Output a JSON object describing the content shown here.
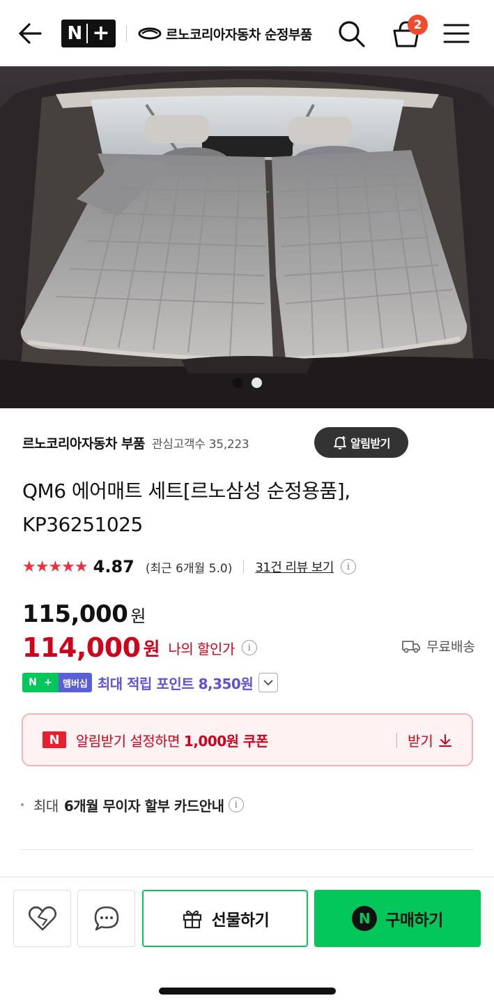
{
  "header": {
    "back_icon": "arrow-left-icon",
    "nplus_n": "N",
    "nplus_plus": "+",
    "brand_name": "르노코리아자동차 순정부품",
    "search_icon": "search-icon",
    "cart_icon": "shopping-bag-icon",
    "cart_count": "2",
    "menu_icon": "hamburger-menu-icon"
  },
  "gallery": {
    "image_alt": "car trunk with inflatable air mattress",
    "slides": 2,
    "active_index": 0
  },
  "product": {
    "seller": "르노코리아자동차 부품",
    "interest_label": "관심고객수 35,223",
    "alarm_button": "알림받기",
    "title": "QM6 에어매트 세트[르노삼성 순정용품], KP36251025",
    "stars": "★★★★★",
    "rating": "4.87",
    "recent_rating": "(최근 6개월 5.0)",
    "review_link": "31건 리뷰 보기",
    "original_price": "115,000",
    "original_won": "원",
    "sale_price": "114,000",
    "sale_won": "원",
    "my_discount": "나의 할인가",
    "shipping": "무료배송",
    "membership_badge_n": "N",
    "membership_badge_plus": "+",
    "membership_badge_label": "멤버십",
    "points_text": "최대 적립 포인트 8,350원",
    "coupon_logo": "N",
    "coupon_text_prefix": "알림받기 설정하면 ",
    "coupon_text_bold": "1,000원 쿠폰",
    "coupon_get": "받기",
    "installment_prefix": "최대 ",
    "installment_bold": "6개월 무이자 할부 카드안내"
  },
  "bottom_bar": {
    "like_icon": "heart-icon",
    "talk_icon": "chat-bubble-icon",
    "gift_label": "선물하기",
    "buy_n": "N",
    "buy_label": "구매하기"
  },
  "colors": {
    "naver_green": "#03c75a",
    "sale_red": "#d0021b",
    "star_red": "#e8333d",
    "points_purple": "#6052d8",
    "badge_orange": "#f04a2f"
  }
}
